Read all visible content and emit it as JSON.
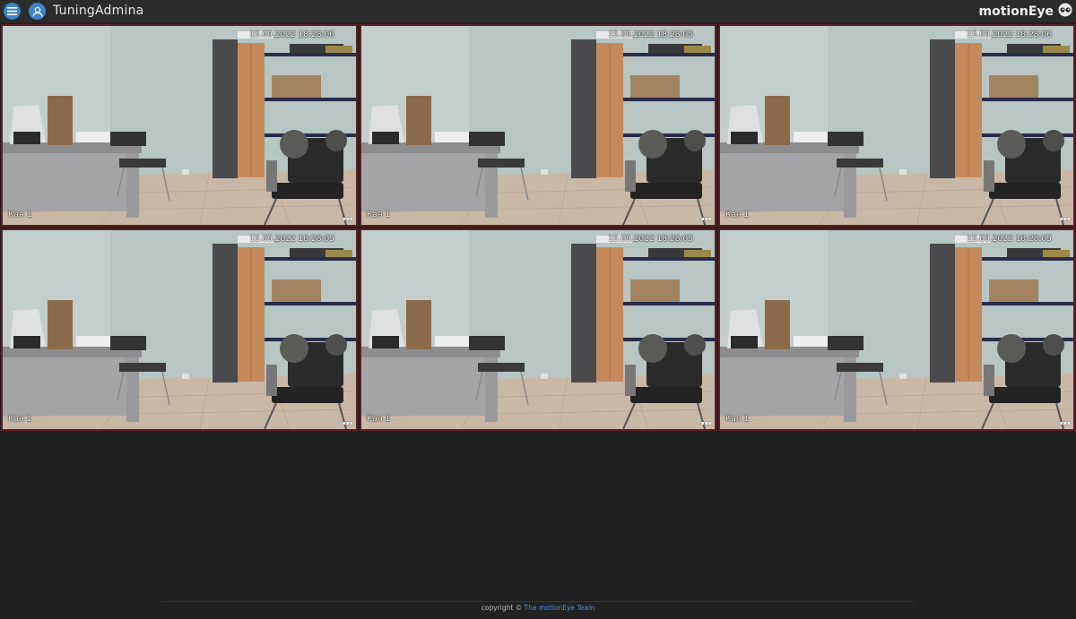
{
  "header": {
    "menu_icon": "hamburger-menu-icon",
    "user_icon": "user-avatar-icon",
    "user_name": "TuningAdmina",
    "brand": "motionEye",
    "logo_icon": "motioneye-eyes-icon",
    "accent": "#3f82c8"
  },
  "cameras": [
    {
      "timestamp": "15.09.2022 18:28:06",
      "name": "Кан 1"
    },
    {
      "timestamp": "15.09.2022 18:28:05",
      "name": "Кан 1"
    },
    {
      "timestamp": "15.09.2022 18:28:06",
      "name": "Кан 1"
    },
    {
      "timestamp": "15.09.2022 18:28:05",
      "name": "Кан 1"
    },
    {
      "timestamp": "15.09.2022 18:28:05",
      "name": "Кан 1"
    },
    {
      "timestamp": "15.09.2022 18:28:05",
      "name": "Кан 1"
    }
  ],
  "frame_border_color": "#5e1e24",
  "footer": {
    "prefix": "copyright ©",
    "link": "The motionEye Team",
    "link_color": "#4a8fd8"
  }
}
